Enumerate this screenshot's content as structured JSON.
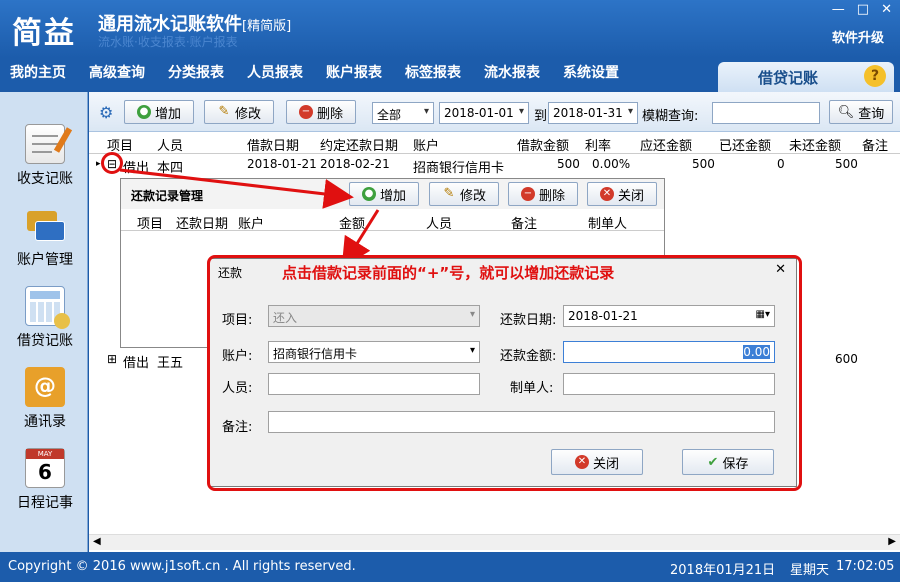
{
  "app": {
    "logo": "简益",
    "title": "通用流水记账软件",
    "edition": "[精简版]",
    "tagline": "流水账·收支报表·账户报表",
    "upgrade": "软件升级",
    "win_min": "—",
    "win_max": "□",
    "win_close": "✕"
  },
  "menu": [
    "我的主页",
    "高级查询",
    "分类报表",
    "人员报表",
    "账户报表",
    "标签报表",
    "流水报表",
    "系统设置"
  ],
  "module_tab": {
    "label": "借贷记账",
    "help": "?"
  },
  "sidebar": [
    {
      "label": "收支记账",
      "icon": "notepad-icon"
    },
    {
      "label": "账户管理",
      "icon": "bank-card-icon"
    },
    {
      "label": "借贷记账",
      "icon": "calculator-icon"
    },
    {
      "label": "通讯录",
      "icon": "address-book-icon"
    },
    {
      "label": "日程记事",
      "icon": "calendar-icon",
      "day": "6",
      "month": "MAY"
    }
  ],
  "toolbar": {
    "add": "增加",
    "edit": "修改",
    "delete": "删除",
    "filter": "全部",
    "date_from": "2018-01-01",
    "to": "到",
    "date_to": "2018-01-31",
    "fuzzy": "模糊查询:",
    "fuzzy_value": "",
    "search": "查询"
  },
  "grid": {
    "headers": [
      "项目",
      "人员",
      "借款日期",
      "约定还款日期",
      "账户",
      "借款金额",
      "利率",
      "应还金额",
      "已还金额",
      "未还金额",
      "备注"
    ],
    "rows": [
      {
        "expander": "⊟",
        "item": "借出",
        "person": "本四",
        "borrow_date": "2018-01-21",
        "due_date": "2018-02-21",
        "account": "招商银行信用卡",
        "amount": "500",
        "rate": "0.00%",
        "due_amount": "500",
        "paid": "0",
        "unpaid": "500"
      },
      {
        "expander": "⊞",
        "item": "借出",
        "person": "王五",
        "unpaid": "600"
      }
    ]
  },
  "subpanel": {
    "title": "还款记录管理",
    "add": "增加",
    "edit": "修改",
    "delete": "删除",
    "close": "关闭",
    "headers": [
      "项目",
      "还款日期",
      "账户",
      "金额",
      "人员",
      "备注",
      "制单人"
    ]
  },
  "annotation": "点击借款记录前面的“+”号，就可以增加还款记录",
  "dialog": {
    "title": "还款",
    "close_x": "✕",
    "item_label": "项目:",
    "item_value": "还入",
    "date_label": "还款日期:",
    "date_value": "2018-01-21",
    "account_label": "账户:",
    "account_value": "招商银行信用卡",
    "amount_label": "还款金额:",
    "amount_value": "0.00",
    "person_label": "人员:",
    "person_value": "",
    "maker_label": "制单人:",
    "maker_value": "",
    "note_label": "备注:",
    "note_value": "",
    "close_btn": "关闭",
    "save_btn": "保存"
  },
  "statusbar": {
    "copyright": "Copyright © 2016 www.j1soft.cn . All rights reserved.",
    "datetime": "2018年01月21日",
    "weekday": "星期天",
    "time": "17:02:05"
  }
}
